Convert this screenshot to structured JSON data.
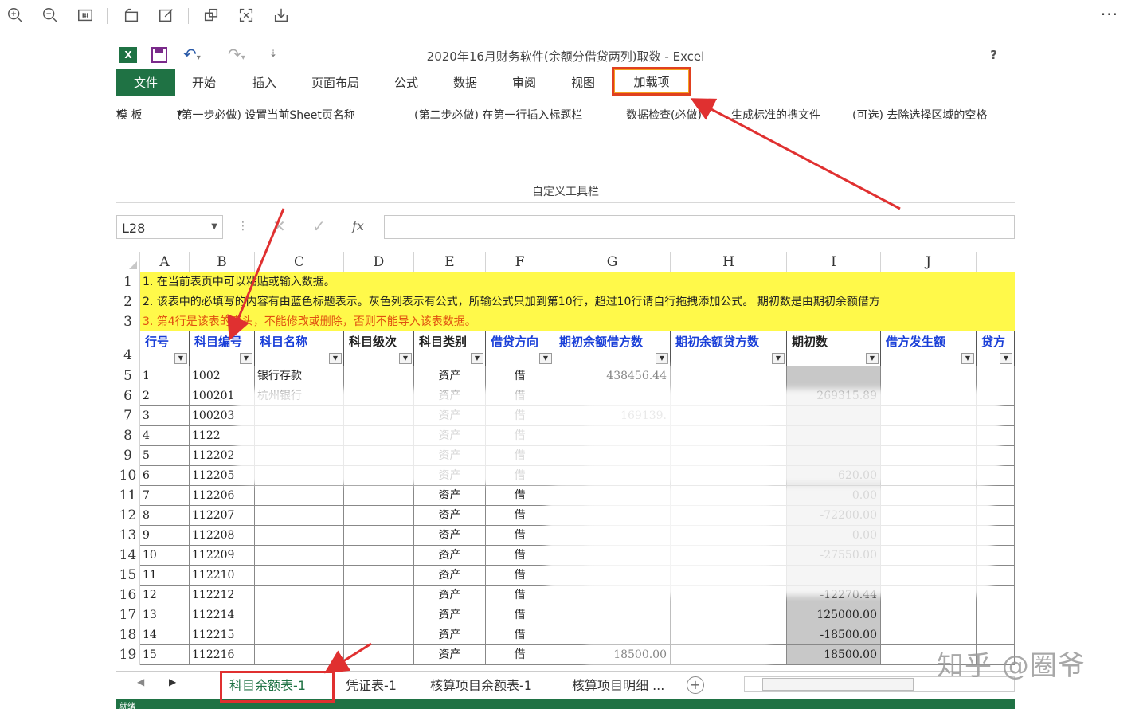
{
  "viewer": {
    "more_label": "···",
    "icons": [
      "zoom-in-icon",
      "zoom-out-icon",
      "actual-size-icon",
      "rotate-icon",
      "edit-icon",
      "crop-icon",
      "fullscreen-icon",
      "download-icon"
    ]
  },
  "excel": {
    "logo": "X",
    "window_title": "2020年16月财务软件(余额分借贷两列)取数 - Excel",
    "help": "?",
    "ribbon_tabs": [
      "文件",
      "开始",
      "插入",
      "页面布局",
      "公式",
      "数据",
      "审阅",
      "视图",
      "加载项"
    ],
    "addin_items": [
      "模 板",
      "(第一步必做) 设置当前Sheet页名称",
      "(第二步必做) 在第一行插入标题栏",
      "数据检查(必做)",
      "生成标准的携文件",
      "(可选) 去除选择区域的空格"
    ],
    "custom_toolbar_label": "自定义工具栏",
    "name_box": "L28",
    "formula_value": "",
    "fx_label": "fx",
    "columns": [
      "A",
      "B",
      "C",
      "D",
      "E",
      "F",
      "G",
      "H",
      "I",
      "J"
    ],
    "notes": [
      "1. 在当前表页中可以粘贴或输入数据。",
      "2. 该表中的必填写的内容有由蓝色标题表示。灰色列表示有公式，所输公式只加到第10行，超过10行请自行拖拽添加公式。    期初数是由期初余额借方",
      "3. 第4行是该表的表头，不能修改或删除，否则不能导入该表数据。"
    ],
    "headers": [
      {
        "label": "行号",
        "blue": true
      },
      {
        "label": "科目编号",
        "blue": true
      },
      {
        "label": "科目名称",
        "blue": true
      },
      {
        "label": "科目级次",
        "blue": false
      },
      {
        "label": "科目类别",
        "blue": false
      },
      {
        "label": "借贷方向",
        "blue": true
      },
      {
        "label": "期初余额借方数",
        "blue": true
      },
      {
        "label": "期初余额贷方数",
        "blue": true
      },
      {
        "label": "期初数",
        "blue": false
      },
      {
        "label": "借方发生额",
        "blue": true
      },
      {
        "label": "贷方",
        "blue": true
      }
    ],
    "row_numbers": [
      "1",
      "2",
      "3",
      "4",
      "5",
      "6",
      "7",
      "8",
      "9",
      "10",
      "11",
      "12",
      "13",
      "14",
      "15",
      "16",
      "17",
      "18",
      "19"
    ],
    "rows": [
      {
        "a": "1",
        "b": "1002",
        "c": "银行存款",
        "e": "资产",
        "f": "借",
        "g": "438456.44",
        "h": "",
        "i": "",
        "j": ""
      },
      {
        "a": "2",
        "b": "100201",
        "c": "杭州银行",
        "e": "资产",
        "f": "借",
        "g": "",
        "h": "",
        "i": "269315.89",
        "j": ""
      },
      {
        "a": "3",
        "b": "100203",
        "c": "",
        "e": "资产",
        "f": "借",
        "g": "169139.",
        "h": "",
        "i": "",
        "j": ""
      },
      {
        "a": "4",
        "b": "1122",
        "c": "",
        "e": "资产",
        "f": "借",
        "g": "",
        "h": "",
        "i": "",
        "j": ""
      },
      {
        "a": "5",
        "b": "112202",
        "c": "",
        "e": "资产",
        "f": "借",
        "g": "",
        "h": "",
        "i": "",
        "j": ""
      },
      {
        "a": "6",
        "b": "112205",
        "c": "",
        "e": "资产",
        "f": "借",
        "g": "",
        "h": "",
        "i": "620.00",
        "j": ""
      },
      {
        "a": "7",
        "b": "112206",
        "c": "",
        "e": "资产",
        "f": "借",
        "g": "",
        "h": "",
        "i": "0.00",
        "j": ""
      },
      {
        "a": "8",
        "b": "112207",
        "c": "",
        "e": "资产",
        "f": "借",
        "g": "",
        "h": "",
        "i": "-72200.00",
        "j": ""
      },
      {
        "a": "9",
        "b": "112208",
        "c": "",
        "e": "资产",
        "f": "借",
        "g": "",
        "h": "",
        "i": "0.00",
        "j": ""
      },
      {
        "a": "10",
        "b": "112209",
        "c": "",
        "e": "资产",
        "f": "借",
        "g": "",
        "h": "",
        "i": "-27550.00",
        "j": ""
      },
      {
        "a": "11",
        "b": "112210",
        "c": "",
        "e": "资产",
        "f": "借",
        "g": "",
        "h": "",
        "i": "",
        "j": ""
      },
      {
        "a": "12",
        "b": "112212",
        "c": "",
        "e": "资产",
        "f": "借",
        "g": "",
        "h": "",
        "i": "-12270.44",
        "j": ""
      },
      {
        "a": "13",
        "b": "112214",
        "c": "",
        "e": "资产",
        "f": "借",
        "g": "",
        "h": "",
        "i": "125000.00",
        "j": ""
      },
      {
        "a": "14",
        "b": "112215",
        "c": "",
        "e": "资产",
        "f": "借",
        "g": "",
        "h": "",
        "i": "-18500.00",
        "j": ""
      },
      {
        "a": "15",
        "b": "112216",
        "c": "",
        "e": "资产",
        "f": "借",
        "g": "18500.00",
        "h": "",
        "i": "18500.00",
        "j": ""
      }
    ],
    "sheet_tabs": [
      "科目余额表-1",
      "凭证表-1",
      "核算项目余额表-1",
      "核算项目明细 ..."
    ],
    "status_text": "就绪"
  },
  "watermark": "知乎 @圈爷",
  "annotation_color": "#e03030"
}
